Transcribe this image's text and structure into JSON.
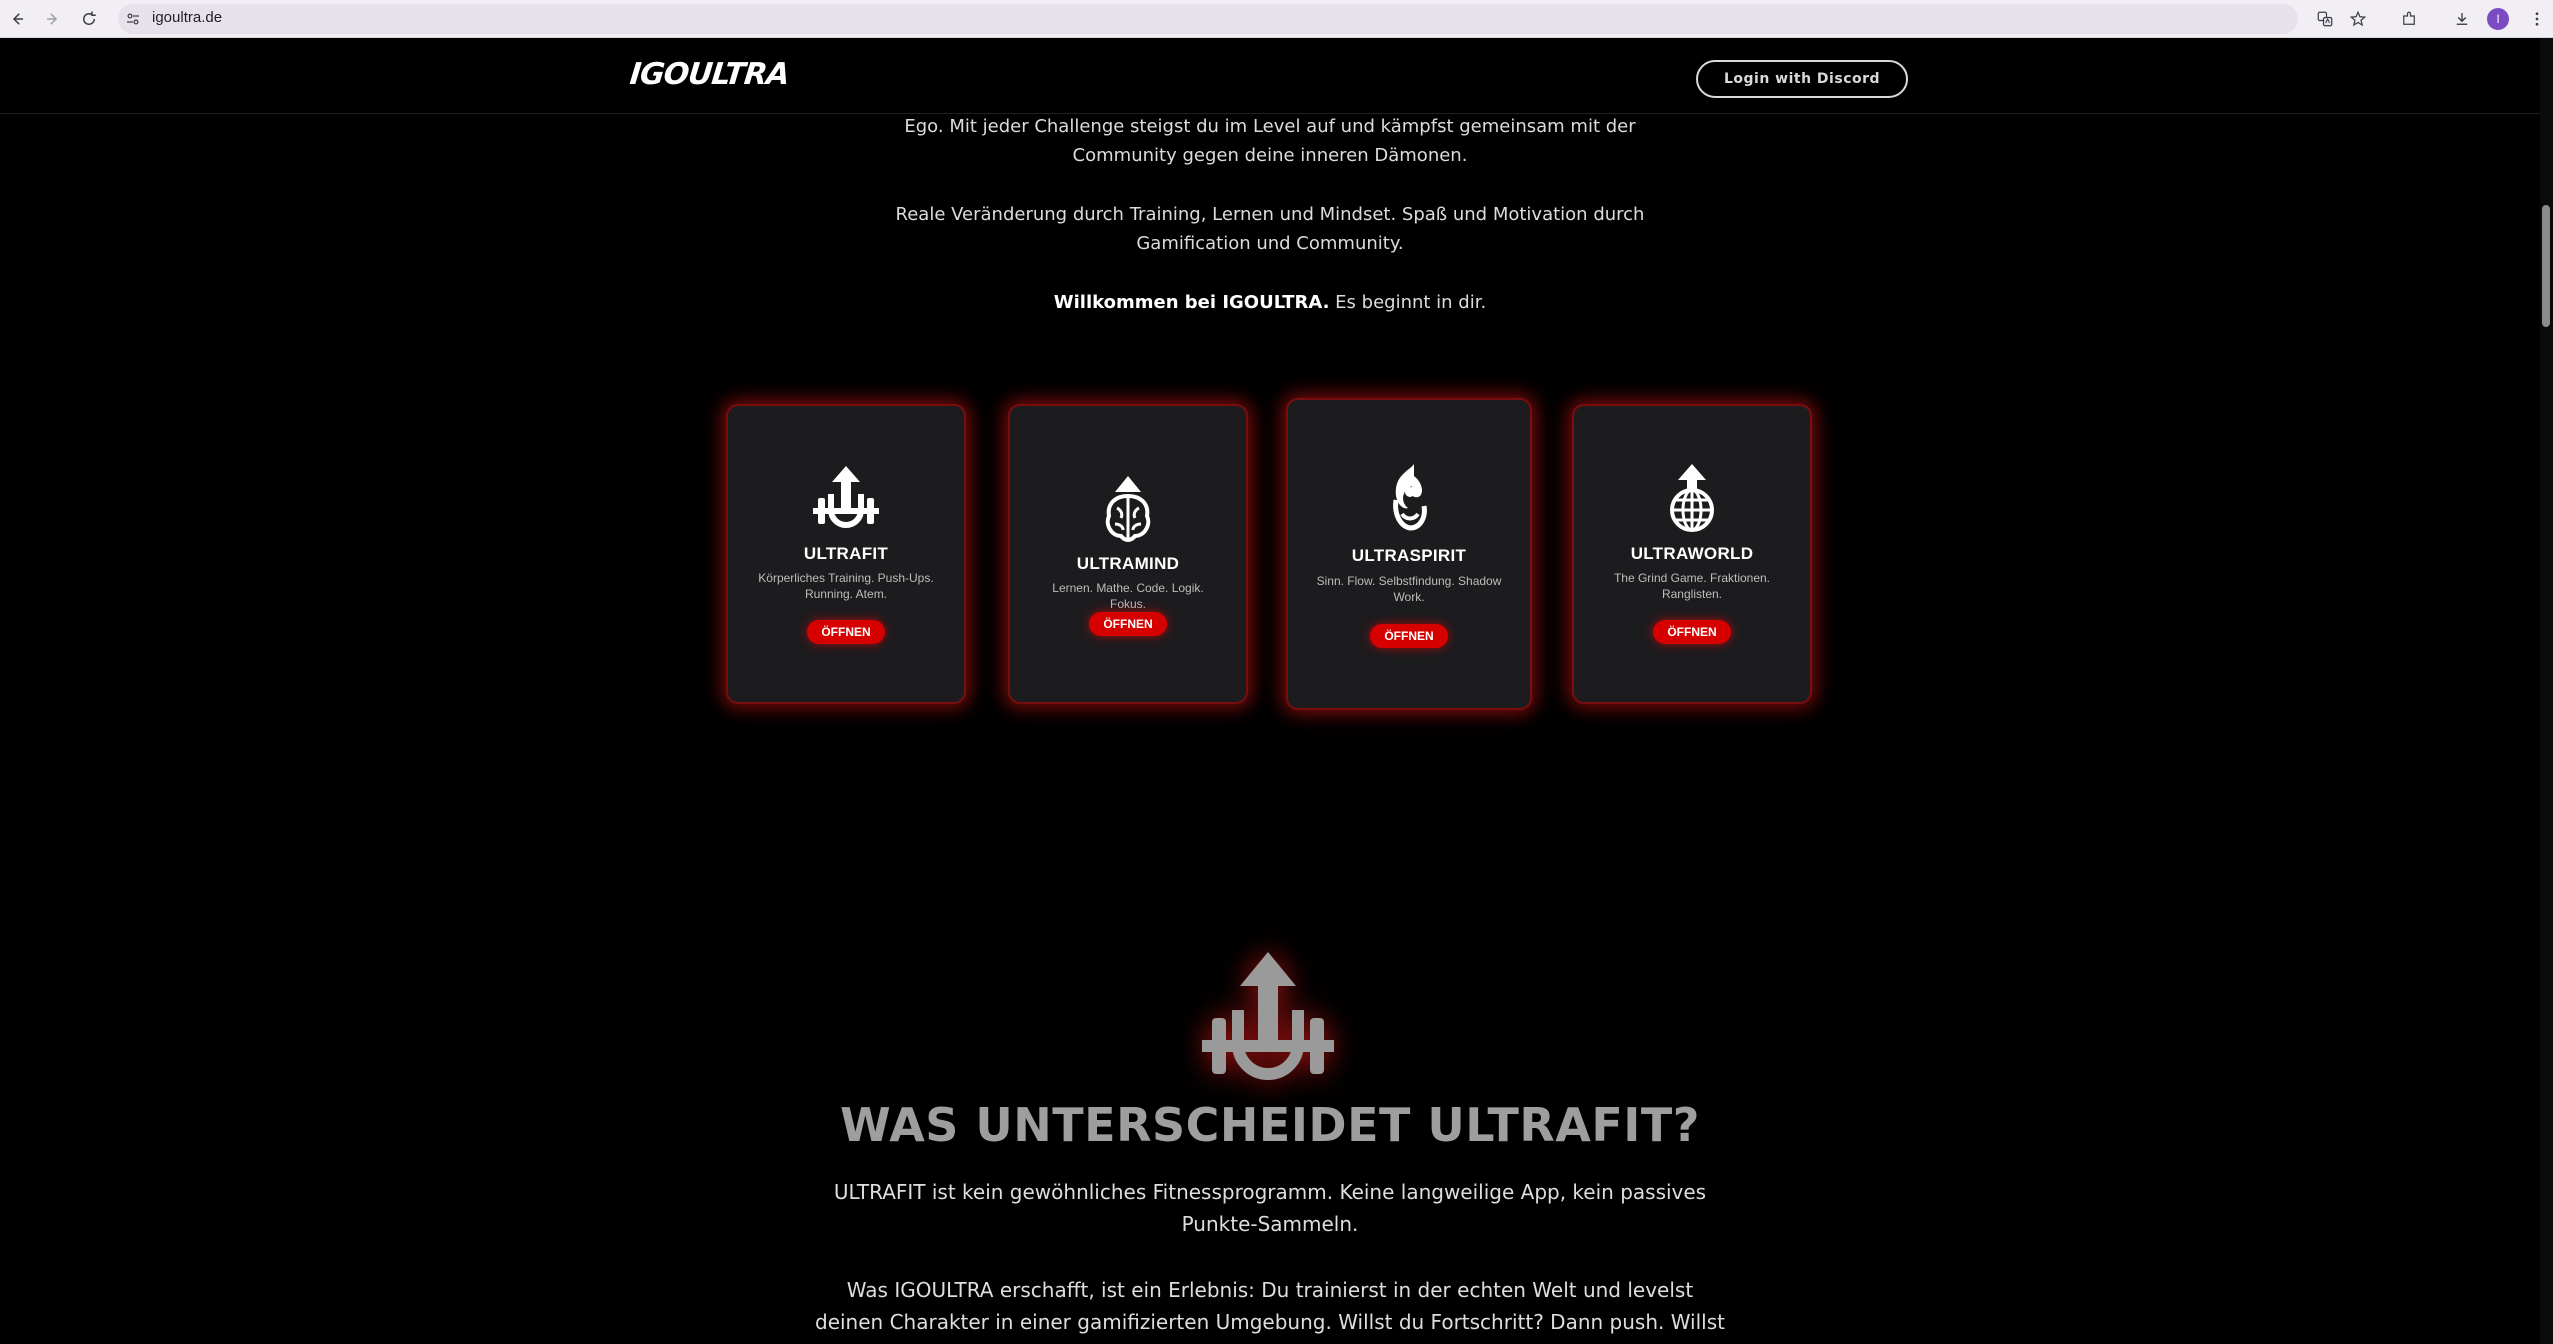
{
  "browser": {
    "url": "igoultra.de",
    "profile_initial": "I"
  },
  "header": {
    "logo": "IGOULTRA",
    "login_label": "Login with Discord"
  },
  "intro": {
    "line1": "Ego. Mit jeder Challenge steigst du im Level auf und kämpfst gemeinsam mit der Community gegen deine inneren Dämonen.",
    "line2": "Reale Veränderung durch Training, Lernen und Mindset. Spaß und Motivation durch Gamification und Community.",
    "welcome_bold": "Willkommen bei IGOULTRA.",
    "welcome_rest": " Es beginnt in dir."
  },
  "cards": [
    {
      "title": "ULTRAFIT",
      "desc": "Körperliches Training. Push-Ups. Running. Atem.",
      "button": "ÖFFNEN",
      "icon": "barbell-arrow-icon"
    },
    {
      "title": "ULTRAMIND",
      "desc": "Lernen. Mathe. Code. Logik. Fokus.",
      "button": "ÖFFNEN",
      "icon": "brain-arrow-icon"
    },
    {
      "title": "ULTRASPIRIT",
      "desc": "Sinn. Flow. Selbstfindung. Shadow Work.",
      "button": "ÖFFNEN",
      "icon": "spirit-flame-icon"
    },
    {
      "title": "ULTRAWORLD",
      "desc": "The Grind Game. Fraktionen. Ranglisten.",
      "button": "ÖFFNEN",
      "icon": "globe-arrow-icon"
    }
  ],
  "section": {
    "title": "WAS UNTERSCHEIDET ULTRAFIT?",
    "p1": "ULTRAFIT ist kein gewöhnliches Fitnessprogramm. Keine langweilige App, kein passives Punkte-Sammeln.",
    "p2": "Was IGOULTRA erschafft, ist ein Erlebnis: Du trainierst in der echten Welt und levelst deinen Charakter in einer gamifizierten Umgebung. Willst du Fortschritt? Dann push. Willst du Fokus? Dann atme. Willst"
  }
}
